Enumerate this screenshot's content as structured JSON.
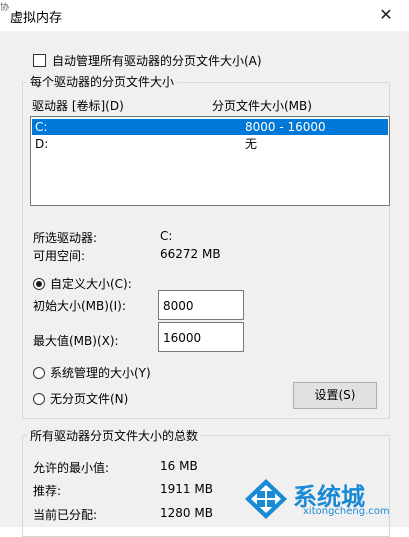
{
  "window": {
    "title": "虚拟内存",
    "top_mark": "协",
    "close_glyph": "✕"
  },
  "auto_manage": {
    "label": "自动管理所有驱动器的分页文件大小(A)",
    "checked": false
  },
  "per_drive": {
    "group_title": "每个驱动器的分页文件大小",
    "col_drive": "驱动器 [卷标](D)",
    "col_size": "分页文件大小(MB)",
    "rows": [
      {
        "drive": "C:",
        "size": "8000 - 16000",
        "selected": true
      },
      {
        "drive": "D:",
        "size": "无",
        "selected": false
      }
    ],
    "selected_drive_label": "所选驱动器:",
    "selected_drive_value": "C:",
    "free_space_label": "可用空间:",
    "free_space_value": "66272 MB",
    "custom_size_label": "自定义大小(C):",
    "initial_size_label": "初始大小(MB)(I):",
    "initial_size_value": "8000",
    "max_size_label": "最大值(MB)(X):",
    "max_size_value": "16000",
    "system_managed_label": "系统管理的大小(Y)",
    "no_paging_label": "无分页文件(N)",
    "set_button": "设置(S)"
  },
  "totals": {
    "group_title": "所有驱动器分页文件大小的总数",
    "min_label": "允许的最小值:",
    "min_value": "16 MB",
    "recommended_label": "推荐:",
    "recommended_value": "1911 MB",
    "allocated_label": "当前已分配:",
    "allocated_value": "1280 MB"
  },
  "watermark": {
    "text": "系统城",
    "url": "xitongcheng.com",
    "color": "#1a8ad4"
  }
}
